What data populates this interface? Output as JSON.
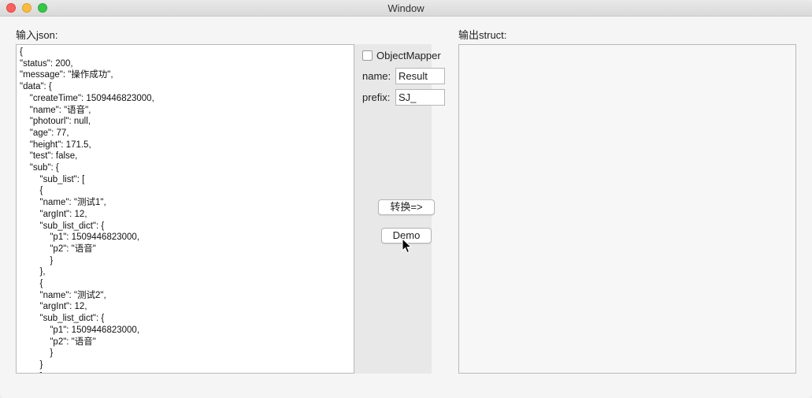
{
  "window": {
    "title": "Window"
  },
  "input": {
    "label": "输入json:",
    "lines": [
      "{",
      "\"status\": 200,",
      "\"message\": \"操作成功\",",
      "\"data\": {",
      "    \"createTime\": 1509446823000,",
      "    \"name\": \"语音\",",
      "    \"photourl\": null,",
      "    \"age\": 77,",
      "    \"height\": 171.5,",
      "    \"test\": false,",
      "    \"sub\": {",
      "        \"sub_list\": [",
      "        {",
      "        \"name\": \"测试1\",",
      "        \"argInt\": 12,",
      "        \"sub_list_dict\": {",
      "            \"p1\": 1509446823000,",
      "            \"p2\": \"语音\"",
      "            }",
      "        },",
      "        {",
      "        \"name\": \"测试2\",",
      "        \"argInt\": 12,",
      "        \"sub_list_dict\": {",
      "            \"p1\": 1509446823000,",
      "            \"p2\": \"语音\"",
      "            }",
      "        }",
      "        ]"
    ]
  },
  "options": {
    "object_mapper_label": "ObjectMapper",
    "object_mapper_checked": false,
    "name_label": "name:",
    "name_value": "Result",
    "prefix_label": "prefix:",
    "prefix_value": "SJ_"
  },
  "actions": {
    "convert_label": "转换=>",
    "demo_label": "Demo"
  },
  "output": {
    "label": "输出struct:",
    "content": ""
  }
}
